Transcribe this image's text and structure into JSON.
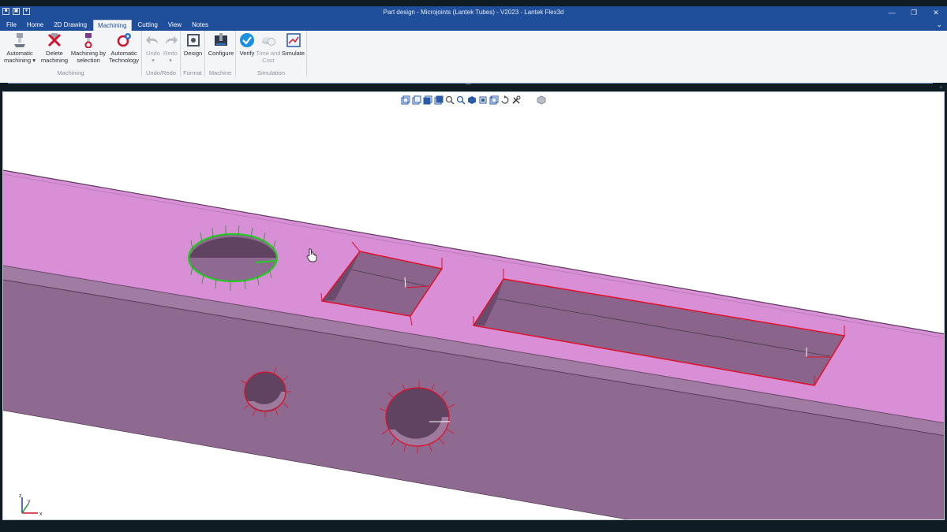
{
  "window": {
    "title": "Part design - Microjoints (Lantek Tubes) - V2023 - Lantek Flex3d",
    "controls": {
      "minimize": "—",
      "restore": "❐",
      "close": "✕"
    }
  },
  "menu": {
    "tabs": [
      "File",
      "Home",
      "2D Drawing",
      "Machining",
      "Cutting",
      "View",
      "Notes"
    ],
    "active": "Machining",
    "collapse_glyph": "⌄"
  },
  "ribbon": {
    "groups": {
      "machining": "Machining",
      "undo_redo": "Undo/Redo",
      "format": "Format",
      "machine": "Machine",
      "simulation": "Simulation"
    },
    "buttons": {
      "automatic_machining": [
        "Automatic",
        "machining ▾"
      ],
      "delete_machining": [
        "Delete",
        "machining"
      ],
      "machining_by_selection": [
        "Machining by",
        "selection"
      ],
      "automatic_technology": [
        "Automatic",
        "Technology"
      ],
      "undo": [
        "Undo",
        "▾"
      ],
      "redo": [
        "Redo",
        "▾"
      ],
      "design": [
        "Design"
      ],
      "configure": [
        "Configure"
      ],
      "verify": [
        "Verify"
      ],
      "time_and_cost": [
        "Time and",
        "Cost"
      ],
      "simulate": [
        "Simulate"
      ]
    }
  },
  "viewport": {
    "axes": {
      "x": "x",
      "y": "y",
      "z": "z"
    }
  },
  "colors": {
    "titlebar": "#1f4e9a",
    "tube_top": "#d98fd6",
    "tube_side": "#8f6a90",
    "tube_side_top": "#a07ca2",
    "selected_contour": "#22cc22",
    "contour": "#e0102a"
  }
}
